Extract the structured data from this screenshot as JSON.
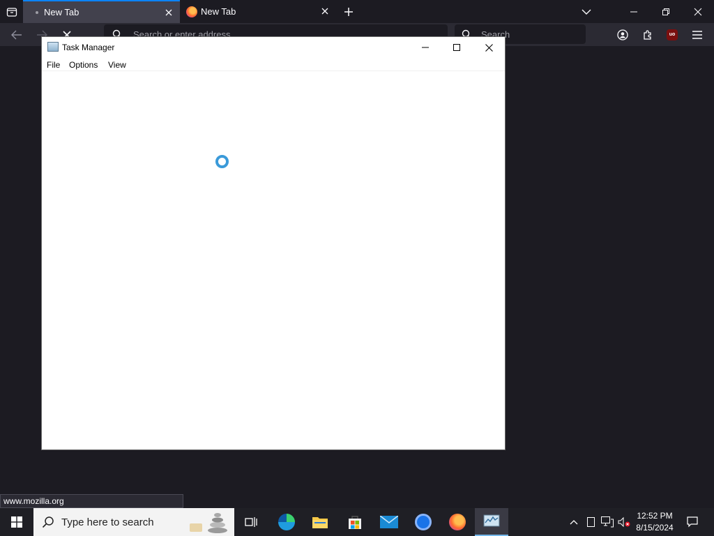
{
  "browser": {
    "tabs": [
      {
        "title": "New Tab",
        "active": true
      },
      {
        "title": "New Tab",
        "active": false
      }
    ],
    "urlbar_placeholder": "Search or enter address",
    "searchbar_placeholder": "Search",
    "status_url": "www.mozilla.org",
    "accent_color": "#0b84ff",
    "extension_badge": "uo"
  },
  "task_manager": {
    "title": "Task Manager",
    "menu": [
      "File",
      "Options",
      "View"
    ],
    "loading": true
  },
  "taskbar": {
    "search_placeholder": "Type here to search",
    "apps": [
      "task-view-icon",
      "edge-icon",
      "file-explorer-icon",
      "store-icon",
      "mail-icon",
      "chrome-icon",
      "firefox-icon",
      "task-manager-icon"
    ],
    "active_app": "task-manager-icon",
    "time": "12:52 PM",
    "date": "8/15/2024"
  }
}
